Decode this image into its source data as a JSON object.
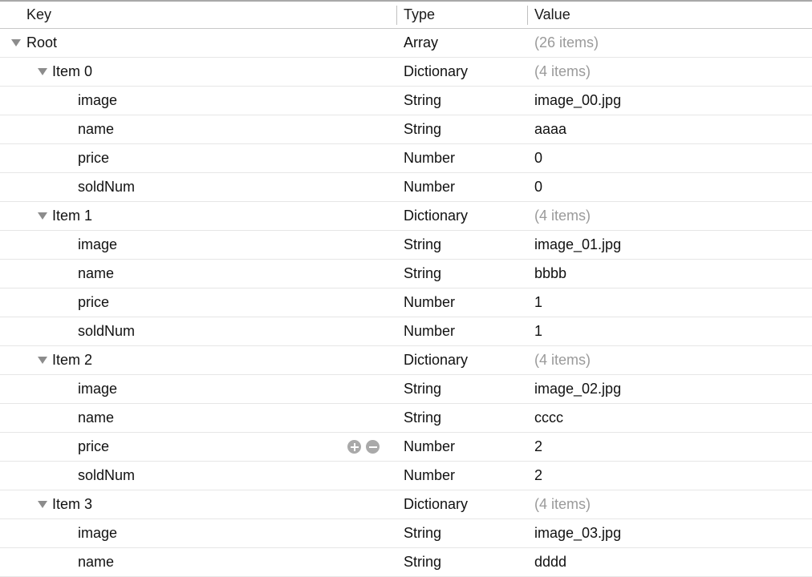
{
  "header": {
    "key_label": "Key",
    "type_label": "Type",
    "value_label": "Value"
  },
  "icons": {
    "disclosure_open": "triangle-down-icon",
    "add": "add-circle-icon",
    "remove": "remove-circle-icon"
  },
  "colors": {
    "row_background": "#ffffff",
    "row_separator": "#e6e6e6",
    "header_top_border": "#a8a8a8",
    "header_bottom_border": "#c8c8c8",
    "text": "#111111",
    "muted_text": "#9a9a9a",
    "twisty": "#8c8c8c",
    "stepper_button": "#a9a9a9"
  },
  "rows": [
    {
      "depth": 0,
      "expanded": true,
      "key": "Root",
      "type": "Array",
      "value": "(26 items)",
      "muted": true,
      "stepper": false
    },
    {
      "depth": 1,
      "expanded": true,
      "key": "Item 0",
      "type": "Dictionary",
      "value": "(4 items)",
      "muted": true,
      "stepper": false
    },
    {
      "depth": 2,
      "expanded": false,
      "key": "image",
      "type": "String",
      "value": "image_00.jpg",
      "muted": false,
      "stepper": false
    },
    {
      "depth": 2,
      "expanded": false,
      "key": "name",
      "type": "String",
      "value": "aaaa",
      "muted": false,
      "stepper": false
    },
    {
      "depth": 2,
      "expanded": false,
      "key": "price",
      "type": "Number",
      "value": "0",
      "muted": false,
      "stepper": false
    },
    {
      "depth": 2,
      "expanded": false,
      "key": "soldNum",
      "type": "Number",
      "value": "0",
      "muted": false,
      "stepper": false
    },
    {
      "depth": 1,
      "expanded": true,
      "key": "Item 1",
      "type": "Dictionary",
      "value": "(4 items)",
      "muted": true,
      "stepper": false
    },
    {
      "depth": 2,
      "expanded": false,
      "key": "image",
      "type": "String",
      "value": "image_01.jpg",
      "muted": false,
      "stepper": false
    },
    {
      "depth": 2,
      "expanded": false,
      "key": "name",
      "type": "String",
      "value": "bbbb",
      "muted": false,
      "stepper": false
    },
    {
      "depth": 2,
      "expanded": false,
      "key": "price",
      "type": "Number",
      "value": "1",
      "muted": false,
      "stepper": false
    },
    {
      "depth": 2,
      "expanded": false,
      "key": "soldNum",
      "type": "Number",
      "value": "1",
      "muted": false,
      "stepper": false
    },
    {
      "depth": 1,
      "expanded": true,
      "key": "Item 2",
      "type": "Dictionary",
      "value": "(4 items)",
      "muted": true,
      "stepper": false
    },
    {
      "depth": 2,
      "expanded": false,
      "key": "image",
      "type": "String",
      "value": "image_02.jpg",
      "muted": false,
      "stepper": false
    },
    {
      "depth": 2,
      "expanded": false,
      "key": "name",
      "type": "String",
      "value": "cccc",
      "muted": false,
      "stepper": false
    },
    {
      "depth": 2,
      "expanded": false,
      "key": "price",
      "type": "Number",
      "value": "2",
      "muted": false,
      "stepper": true
    },
    {
      "depth": 2,
      "expanded": false,
      "key": "soldNum",
      "type": "Number",
      "value": "2",
      "muted": false,
      "stepper": false
    },
    {
      "depth": 1,
      "expanded": true,
      "key": "Item 3",
      "type": "Dictionary",
      "value": "(4 items)",
      "muted": true,
      "stepper": false
    },
    {
      "depth": 2,
      "expanded": false,
      "key": "image",
      "type": "String",
      "value": "image_03.jpg",
      "muted": false,
      "stepper": false
    },
    {
      "depth": 2,
      "expanded": false,
      "key": "name",
      "type": "String",
      "value": "dddd",
      "muted": false,
      "stepper": false
    }
  ]
}
